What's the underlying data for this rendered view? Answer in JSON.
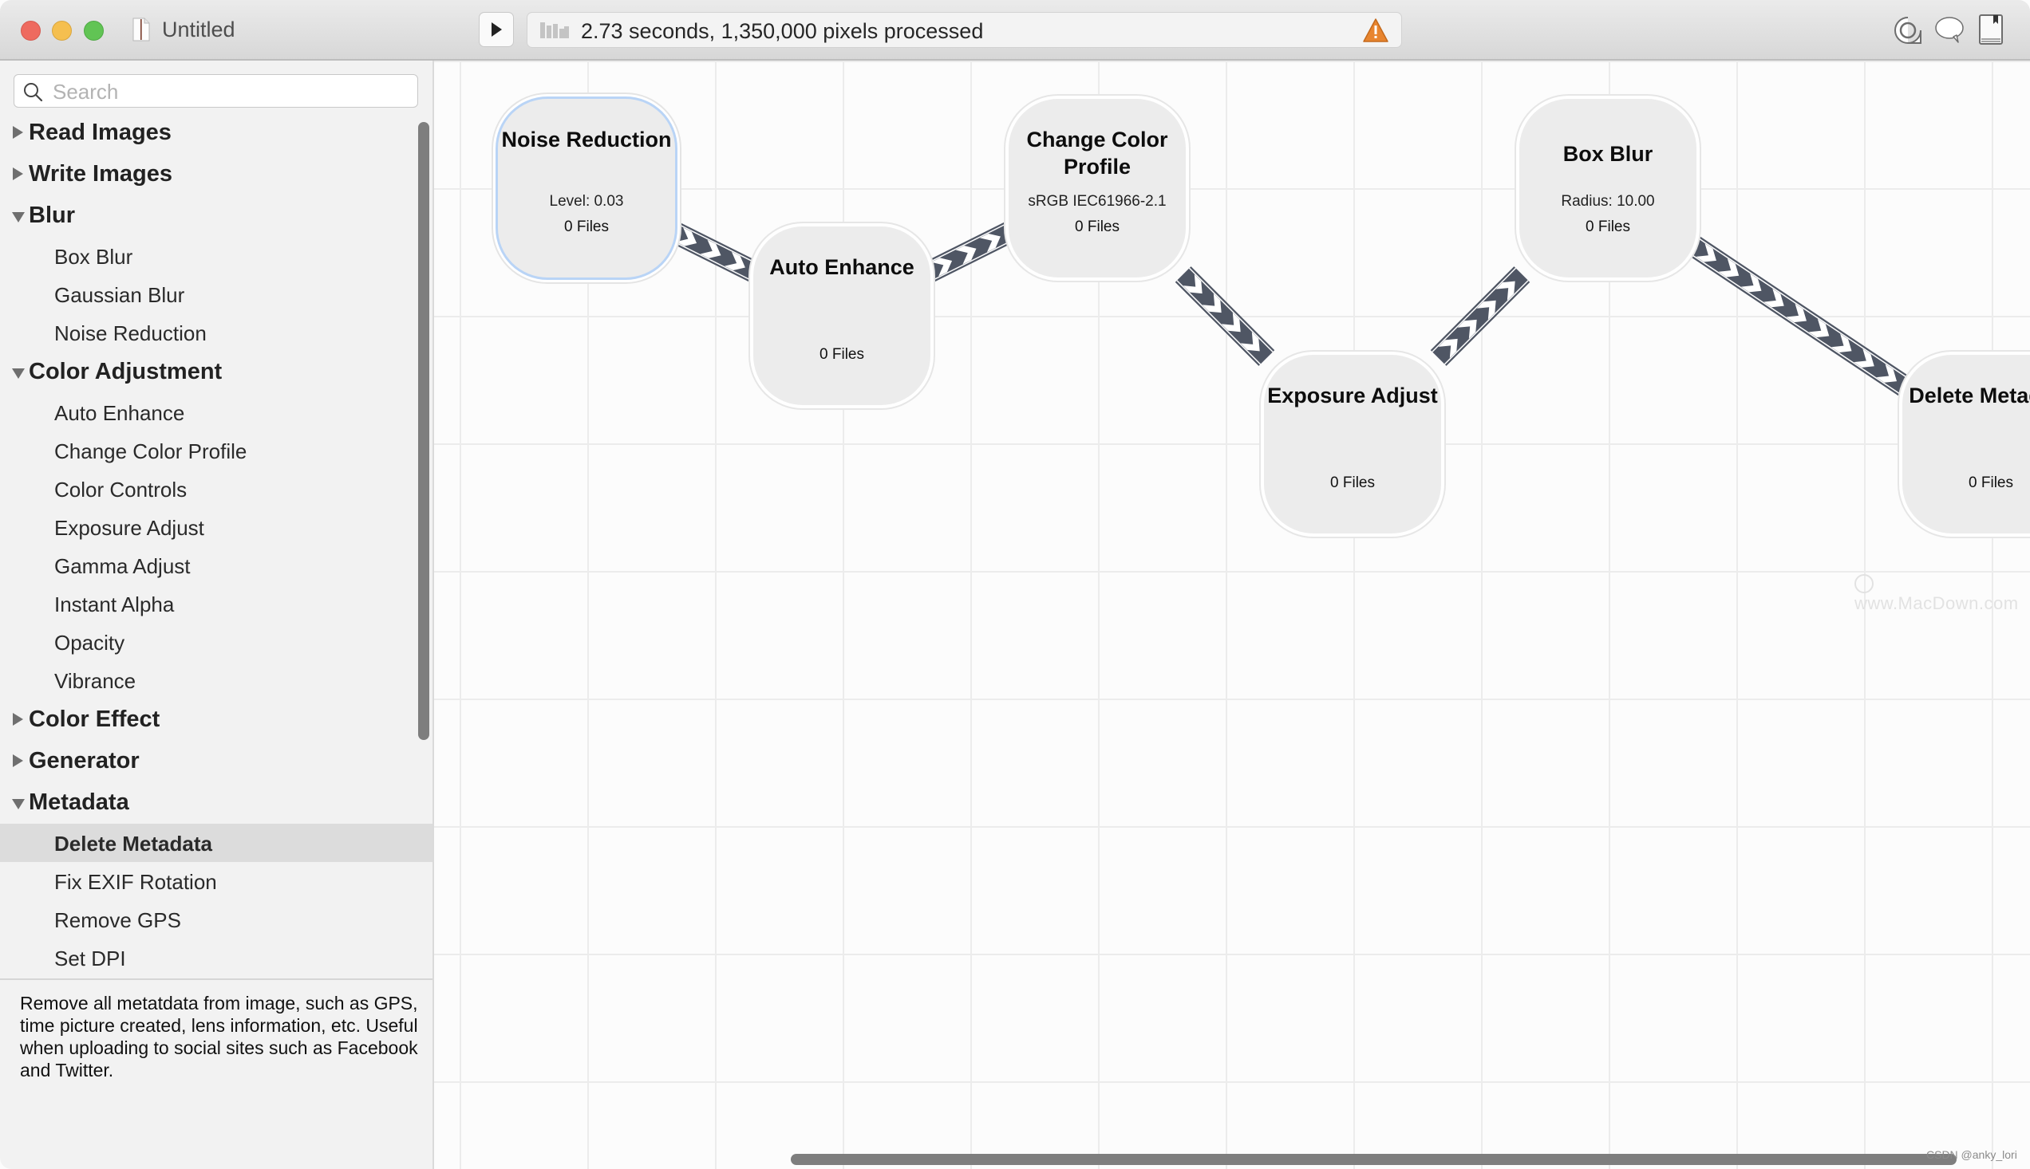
{
  "window": {
    "title": "Untitled",
    "doc_icon": "document-icon",
    "traffic_lights": [
      "close",
      "minimize",
      "zoom"
    ]
  },
  "toolbar": {
    "run_icon": "play-icon",
    "status_icon": "progress-icon",
    "status_text": "2.73 seconds, 1,350,000 pixels processed",
    "warning_icon": "warning-triangle-icon",
    "warning_color": "#e8852f",
    "right_icons": [
      "inspector-icon",
      "speech-bubble-icon",
      "book-icon"
    ]
  },
  "sidebar": {
    "search_placeholder": "Search",
    "search_value": "",
    "tree": [
      {
        "label": "Read Images",
        "expanded": false,
        "items": []
      },
      {
        "label": "Write Images",
        "expanded": false,
        "items": []
      },
      {
        "label": "Blur",
        "expanded": true,
        "items": [
          "Box Blur",
          "Gaussian Blur",
          "Noise Reduction"
        ]
      },
      {
        "label": "Color Adjustment",
        "expanded": true,
        "items": [
          "Auto Enhance",
          "Change Color Profile",
          "Color Controls",
          "Exposure Adjust",
          "Gamma Adjust",
          "Instant Alpha",
          "Opacity",
          "Vibrance"
        ]
      },
      {
        "label": "Color Effect",
        "expanded": false,
        "items": []
      },
      {
        "label": "Generator",
        "expanded": false,
        "items": []
      },
      {
        "label": "Metadata",
        "expanded": true,
        "items": [
          "Delete Metadata",
          "Fix EXIF Rotation",
          "Remove GPS",
          "Set DPI"
        ]
      }
    ],
    "selected_item": "Delete Metadata",
    "description": "Remove all metatdata from image, such as GPS, time picture created, lens information, etc. Useful when uploading to social sites such as Facebook and Twitter."
  },
  "canvas": {
    "nodes": [
      {
        "id": "noise-reduction",
        "title": "Noise Reduction",
        "param": "Level: 0.03",
        "files": "0 Files",
        "selected": true
      },
      {
        "id": "auto-enhance",
        "title": "Auto Enhance",
        "param": "",
        "files": "0 Files",
        "selected": false
      },
      {
        "id": "change-color-profile",
        "title": "Change Color Profile",
        "param": "sRGB IEC61966-2.1",
        "files": "0 Files",
        "selected": false
      },
      {
        "id": "exposure-adjust",
        "title": "Exposure Adjust",
        "param": "",
        "files": "0 Files",
        "selected": false
      },
      {
        "id": "box-blur",
        "title": "Box Blur",
        "param": "Radius: 10.00",
        "files": "0 Files",
        "selected": false
      },
      {
        "id": "delete-metadata",
        "title": "Delete Metadata",
        "param": "",
        "files": "0 Files",
        "selected": false
      }
    ],
    "links": [
      {
        "from": "noise-reduction",
        "to": "auto-enhance"
      },
      {
        "from": "auto-enhance",
        "to": "change-color-profile"
      },
      {
        "from": "change-color-profile",
        "to": "exposure-adjust"
      },
      {
        "from": "exposure-adjust",
        "to": "box-blur"
      },
      {
        "from": "box-blur",
        "to": "delete-metadata"
      }
    ],
    "link_color": "#4f5664",
    "selection_color": "#b9d4f6",
    "watermark": "www.MacDown.com",
    "credit": "CSDN @anky_lori"
  }
}
